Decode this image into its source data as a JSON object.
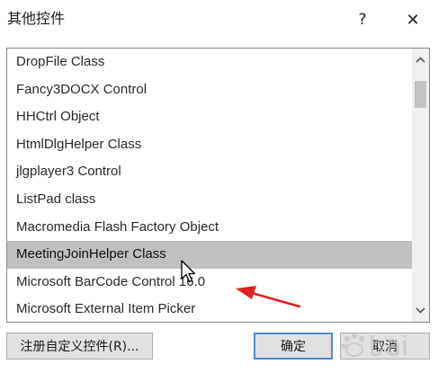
{
  "window": {
    "title": "其他控件",
    "help_glyph": "?",
    "close_glyph": "✕"
  },
  "list": {
    "items": [
      "DropFile Class",
      "Fancy3DOCX Control",
      "HHCtrl Object",
      "HtmlDlgHelper Class",
      "jlgplayer3 Control",
      "ListPad class",
      "Macromedia Flash Factory Object",
      "MeetingJoinHelper Class",
      "Microsoft BarCode Control 16.0",
      "Microsoft External Item Picker"
    ],
    "selected_index": 7
  },
  "buttons": {
    "register_label": "注册自定义控件(R)...",
    "ok_label": "确定",
    "cancel_label": "取消"
  },
  "colors": {
    "selection": "#c0c0c0",
    "annotation_arrow": "#e02020",
    "ok_border": "#4a8ad8"
  },
  "icons": {
    "scroll_up": "chevron-up-icon",
    "scroll_down": "chevron-down-icon",
    "cursor": "mouse-pointer-icon",
    "annotation": "red-arrow-annotation",
    "watermark": "baidu-watermark-logo"
  }
}
